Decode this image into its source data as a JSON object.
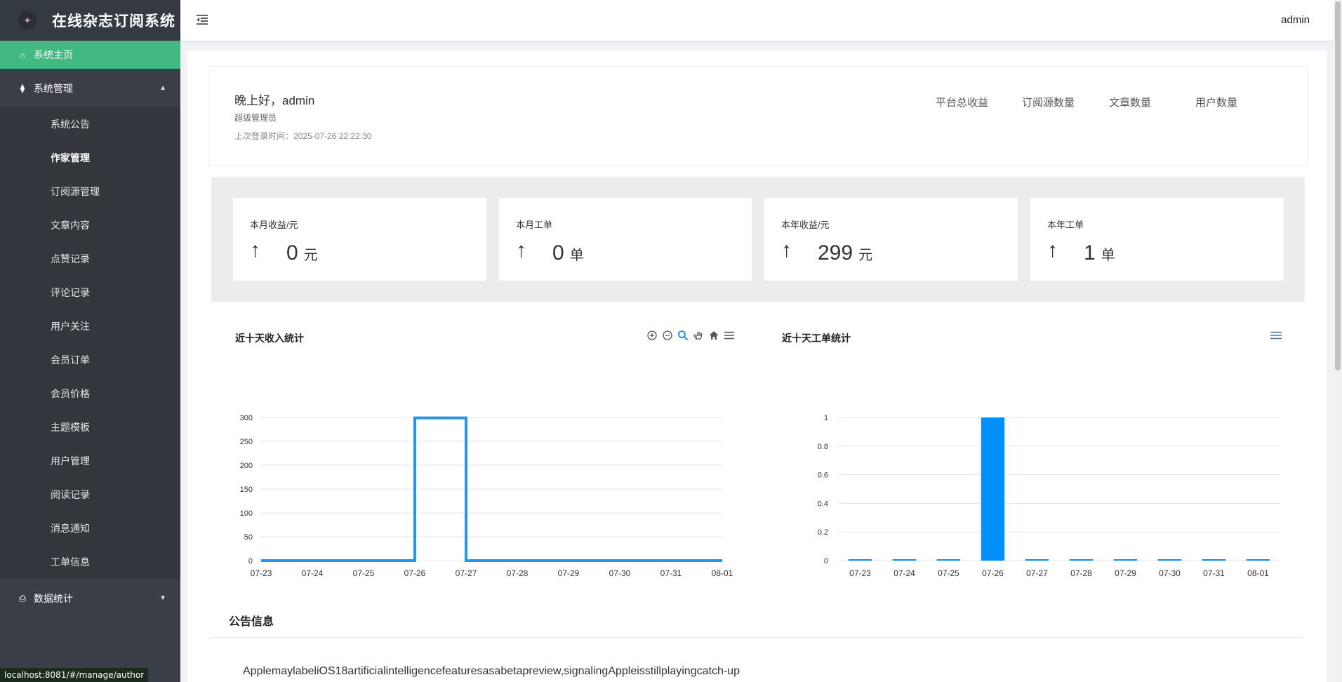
{
  "app": {
    "title": "在线杂志订阅系统"
  },
  "header": {
    "user": "admin"
  },
  "sidebar": {
    "home": "系统主页",
    "system_group": "系统管理",
    "items": [
      "系统公告",
      "作家管理",
      "订阅源管理",
      "文章内容",
      "点赞记录",
      "评论记录",
      "用户关注",
      "会员订单",
      "会员价格",
      "主题模板",
      "用户管理",
      "阅读记录",
      "消息通知",
      "工单信息"
    ],
    "active_item": "作家管理",
    "data_group": "数据统计"
  },
  "welcome": {
    "greeting": "晚上好，admin",
    "role": "超级管理员",
    "last_login": "上次登录时间：2025-07-26 22:22:30",
    "stat_labels": [
      "平台总收益",
      "订阅源数量",
      "文章数量",
      "用户数量"
    ]
  },
  "cards": [
    {
      "title": "本月收益/元",
      "value": "0",
      "unit": "元"
    },
    {
      "title": "本月工单",
      "value": "0",
      "unit": "单"
    },
    {
      "title": "本年收益/元",
      "value": "299",
      "unit": "元"
    },
    {
      "title": "本年工单",
      "value": "1",
      "unit": "单"
    }
  ],
  "chart_data": [
    {
      "type": "line",
      "title": "近十天收入统计",
      "x": [
        "07-23",
        "07-24",
        "07-25",
        "07-26",
        "07-27",
        "07-28",
        "07-29",
        "07-30",
        "07-31",
        "08-01"
      ],
      "values": [
        0,
        0,
        0,
        299,
        0,
        0,
        0,
        0,
        0,
        0
      ],
      "step": true,
      "ylim": [
        0,
        300
      ],
      "yticks": [
        0,
        50,
        100,
        150,
        200,
        250,
        300
      ],
      "grid": true,
      "color": "#2196f3"
    },
    {
      "type": "bar",
      "title": "近十天工单统计",
      "categories": [
        "07-23",
        "07-24",
        "07-25",
        "07-26",
        "07-27",
        "07-28",
        "07-29",
        "07-30",
        "07-31",
        "08-01"
      ],
      "values": [
        0,
        0,
        0,
        1,
        0,
        0,
        0,
        0,
        0,
        0
      ],
      "ylim": [
        0,
        1
      ],
      "yticks": [
        0,
        0.2,
        0.4,
        0.6,
        0.8,
        1
      ],
      "grid": true,
      "color": "#008ffb"
    }
  ],
  "notice": {
    "title": "公告信息",
    "text": "ApplemaylabeliOS18artificialintelligencefeaturesasabetapreview,signalingAppleisstillplayingcatch-up"
  },
  "statusbar": {
    "url": "localhost:8081/#/manage/author"
  }
}
